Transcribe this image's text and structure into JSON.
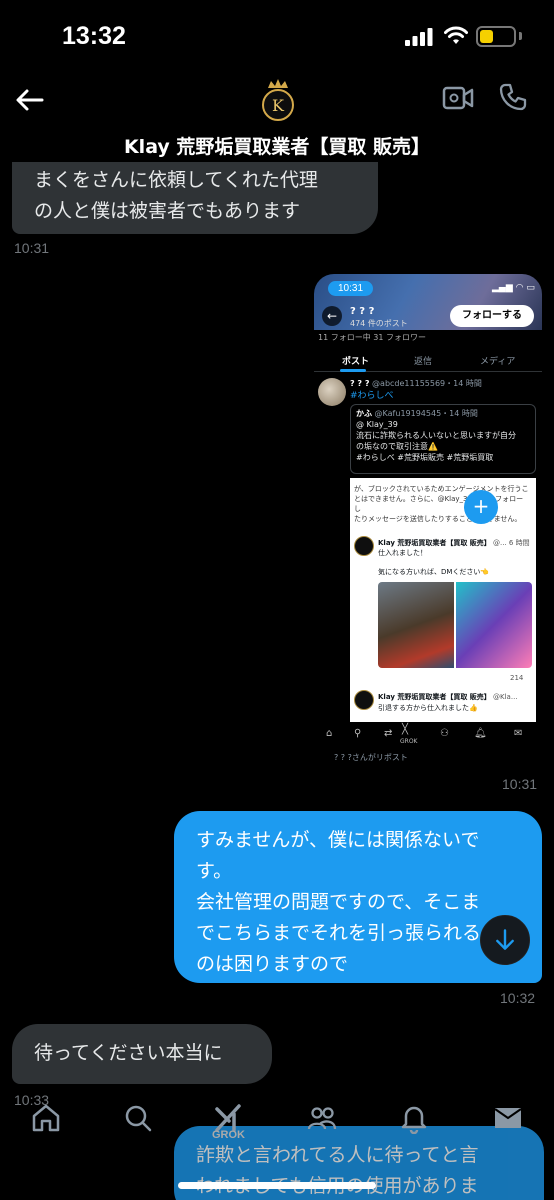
{
  "status_bar": {
    "time": "13:32"
  },
  "header": {
    "title": "Klay 荒野垢買取業者【買取 販売】",
    "logo_letter": "K"
  },
  "messages": [
    {
      "lines": [
        "まくをさんに依頼してくれた代理",
        "の人と僕は被害者でもあります"
      ],
      "time": "10:31"
    },
    {
      "type": "image",
      "time": "10:31"
    },
    {
      "lines": [
        "すみませんが、僕には関係ないで",
        "す。",
        "会社管理の問題ですので、そこま",
        "でこちらまでそれを引っ張られる",
        "のは困りますので"
      ],
      "time": "10:32"
    },
    {
      "lines": [
        "待ってください本当に"
      ],
      "time": "10:33"
    },
    {
      "lines": [
        "詐欺と言われてる人に待ってと言",
        "われましても信用の使用がありま"
      ]
    }
  ],
  "screenshot": {
    "time": "10:31",
    "name": "? ? ?",
    "post_count": "474 件のポスト",
    "follow_label": "フォローする",
    "followers_line": "11 フォロー中  31 フォロワー",
    "tabs": [
      "ポスト",
      "返信",
      "メディア"
    ],
    "post_head_name": "? ? ?",
    "post_head_meta": "@abcde11155569・14 時間",
    "post_hashtag": "#わらしべ",
    "quote_name": "かふ",
    "quote_meta": "@Kafu19194545・14 時間",
    "quote_lines": [
      "@ Klay_39",
      "流石に詐欺られる人いないと思いますが自分",
      "の垢なので取引注意⚠️",
      "#わらしべ #荒野垢販売 #荒野垢買取"
    ],
    "blocked_lines": [
      "が、ブロックされているためエンゲージメントを行うこ",
      "とはできません。さらに、@Klay_39 さんをフォローし",
      "たりメッセージを送信したりすることもできません。"
    ],
    "card1_name": "Klay 荒野垢買取業者【買取 販売】",
    "card1_meta": "@... 6 時間",
    "card1_text1": "仕入れました！",
    "card1_text2": "気になる方いれば、DMください👈",
    "card1_stat": "214",
    "card2_name": "Klay 荒野垢買取業者【買取 販売】",
    "card2_meta": "@Kla...",
    "card2_text": "引退する方から仕入れました👍",
    "nav_label": "GROK",
    "repost": "? ? ?さんがリポスト"
  },
  "tabbar": {
    "grok_label": "GROK"
  },
  "colors": {
    "accent": "#1d9bf0",
    "incoming": "#2f3336",
    "background": "#000000"
  }
}
